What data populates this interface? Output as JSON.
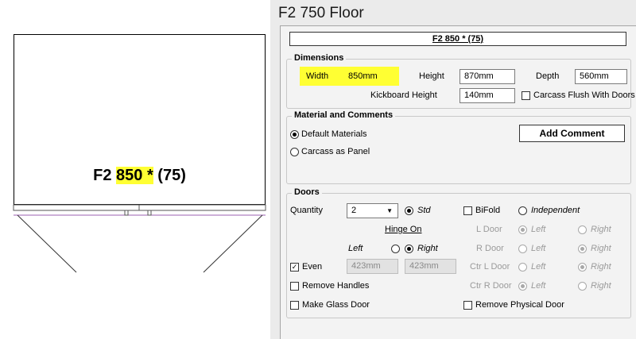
{
  "preview": {
    "cabinet_label_prefix": "F2",
    "cabinet_label_width": "850 *",
    "cabinet_label_suffix": "(75)"
  },
  "window": {
    "title": "F2 750 Floor",
    "cabinet_name": "F2 850 * (75)"
  },
  "dimensions": {
    "group_title": "Dimensions",
    "width_label": "Width",
    "width_value": "850mm",
    "height_label": "Height",
    "height_value": "870mm",
    "depth_label": "Depth",
    "depth_value": "560mm",
    "kickboard_label": "Kickboard Height",
    "kickboard_value": "140mm",
    "carcass_flush_label": "Carcass Flush With Doors",
    "highlight_color": "#ffff33"
  },
  "material": {
    "group_title": "Material and Comments",
    "default_materials_label": "Default Materials",
    "carcass_panel_label": "Carcass as Panel",
    "add_comment_label": "Add Comment"
  },
  "doors": {
    "group_title": "Doors",
    "quantity_label": "Quantity",
    "quantity_value": "2",
    "std_label": "Std",
    "bifold_label": "BiFold",
    "independent_label": "Independent",
    "hinge_on_label": "Hinge On",
    "left_label": "Left",
    "right_label": "Right",
    "l_door_label": "L Door",
    "r_door_label": "R Door",
    "ctr_l_door_label": "Ctr L Door",
    "ctr_r_door_label": "Ctr R Door",
    "even_label": "Even",
    "even_check": "✓",
    "even_left_value": "423mm",
    "even_right_value": "423mm",
    "remove_handles_label": "Remove Handles",
    "make_glass_label": "Make Glass Door",
    "remove_physical_label": "Remove Physical Door"
  }
}
